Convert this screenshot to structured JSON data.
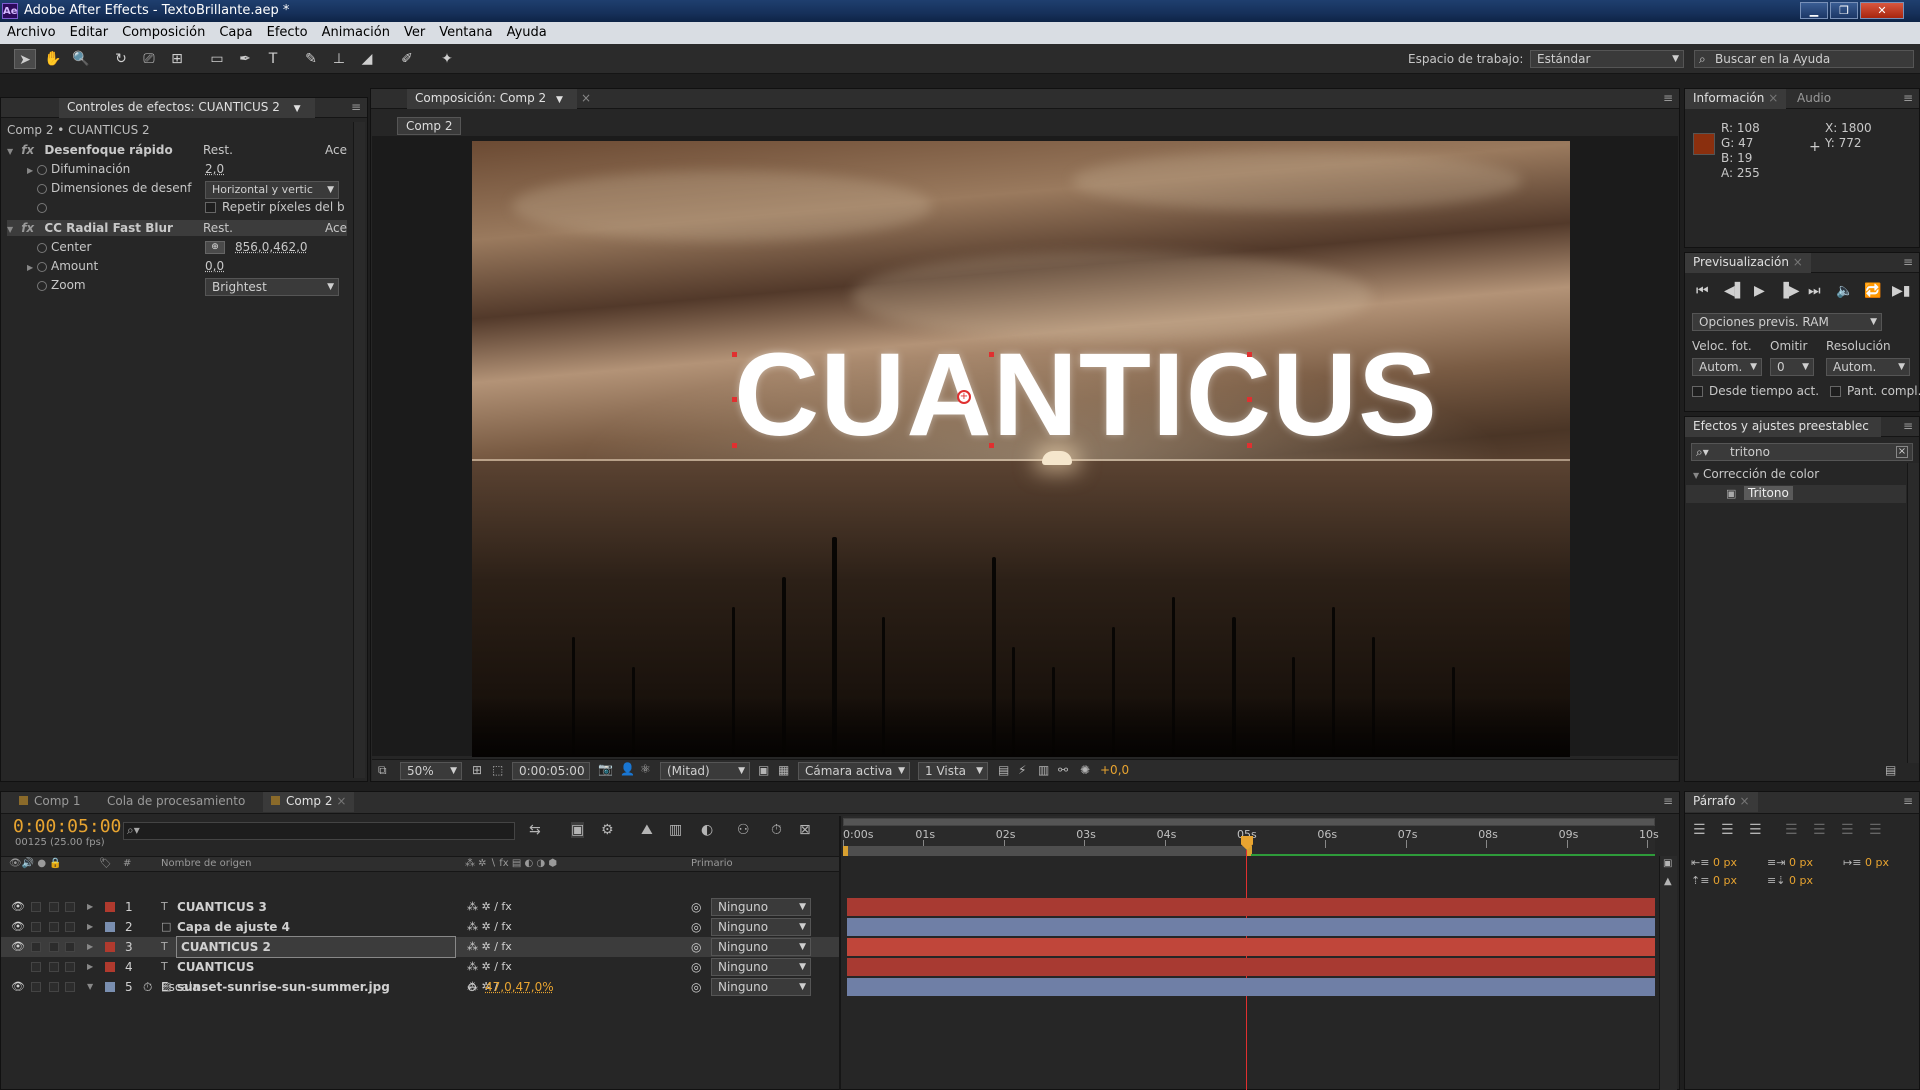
{
  "window": {
    "title": "Adobe After Effects - TextoBrillante.aep *",
    "app_badge": "Ae"
  },
  "menu": [
    "Archivo",
    "Editar",
    "Composición",
    "Capa",
    "Efecto",
    "Animación",
    "Ver",
    "Ventana",
    "Ayuda"
  ],
  "toolbar": {
    "workspace_label": "Espacio de trabajo:",
    "workspace_value": "Estándar",
    "help_search_placeholder": "Buscar en la Ayuda"
  },
  "effects_panel": {
    "tab_label": "Controles de efectos: CUANTICUS 2",
    "breadcrumb": "Comp 2 • CUANTICUS 2",
    "effects": [
      {
        "name": "Desenfoque rápido",
        "reset": "Rest.",
        "about": "Ace",
        "props": [
          {
            "label": "Difuminación",
            "value": "2,0"
          },
          {
            "label": "Dimensiones de desenf",
            "value": "Horizontal y vertic"
          },
          {
            "label": "",
            "value": "Repetir píxeles del b"
          }
        ]
      },
      {
        "name": "CC Radial Fast Blur",
        "reset": "Rest.",
        "about": "Ace",
        "props": [
          {
            "label": "Center",
            "value": "856,0,462,0"
          },
          {
            "label": "Amount",
            "value": "0,0"
          },
          {
            "label": "Zoom",
            "value": "Brightest"
          }
        ]
      }
    ]
  },
  "comp_viewer": {
    "tab_label": "Composición: Comp 2",
    "subtab": "Comp 2",
    "overlay_text": "CUANTICUS",
    "footer": {
      "zoom": "50%",
      "timecode": "0:00:05:00",
      "resolution": "(Mitad)",
      "camera": "Cámara activa",
      "views": "1 Vista",
      "exposure": "+0,0"
    }
  },
  "info_panel": {
    "tabs": [
      "Información",
      "Audio"
    ],
    "color_swatch": "#8a2f0e",
    "r": "R:  108",
    "g": "G:  47",
    "b": "B:  19",
    "a": "A:  255",
    "x": "X:  1800",
    "y": "Y:  772"
  },
  "preview_panel": {
    "tab": "Previsualización",
    "ram_options": "Opciones previs. RAM",
    "fps_label": "Veloc. fot.",
    "skip_label": "Omitir",
    "res_label": "Resolución",
    "fps_value": "Autom.",
    "skip_value": "0",
    "res_value": "Autom.",
    "from_current": "Desde tiempo act.",
    "full_screen": "Pant. compl."
  },
  "presets_panel": {
    "tab": "Efectos y ajustes preestablec",
    "search_value": "tritono",
    "category": "Corrección de color",
    "item": "Tritono"
  },
  "paragraph_panel": {
    "tab": "Párrafo",
    "values": [
      "0 px",
      "0 px",
      "0 px",
      "0 px",
      "0 px"
    ]
  },
  "timeline": {
    "tabs": [
      "Comp 1",
      "Cola de procesamiento",
      "Comp 2"
    ],
    "timecode": "0:00:05:00",
    "frames": "00125 (25.00 fps)",
    "col_num": "#",
    "col_source": "Nombre de origen",
    "col_parent": "Primario",
    "ruler": [
      "0:00s",
      "01s",
      "02s",
      "03s",
      "04s",
      "05s",
      "06s",
      "07s",
      "08s",
      "09s",
      "10s"
    ],
    "layers": [
      {
        "num": "1",
        "name": "CUANTICUS 3",
        "parent": "Ninguno",
        "color": "#b03a2e"
      },
      {
        "num": "2",
        "name": "Capa de ajuste 4",
        "parent": "Ninguno",
        "color": "#7a8fb0"
      },
      {
        "num": "3",
        "name": "CUANTICUS 2",
        "parent": "Ninguno",
        "color": "#b03a2e"
      },
      {
        "num": "4",
        "name": "CUANTICUS",
        "parent": "Ninguno",
        "color": "#b03a2e"
      },
      {
        "num": "5",
        "name": "sunset-sunrise-sun-summer.jpg",
        "parent": "Ninguno",
        "color": "#7a8fb0"
      }
    ],
    "sub_prop": {
      "label": "Escala",
      "value": "47,0,47,0%"
    }
  }
}
